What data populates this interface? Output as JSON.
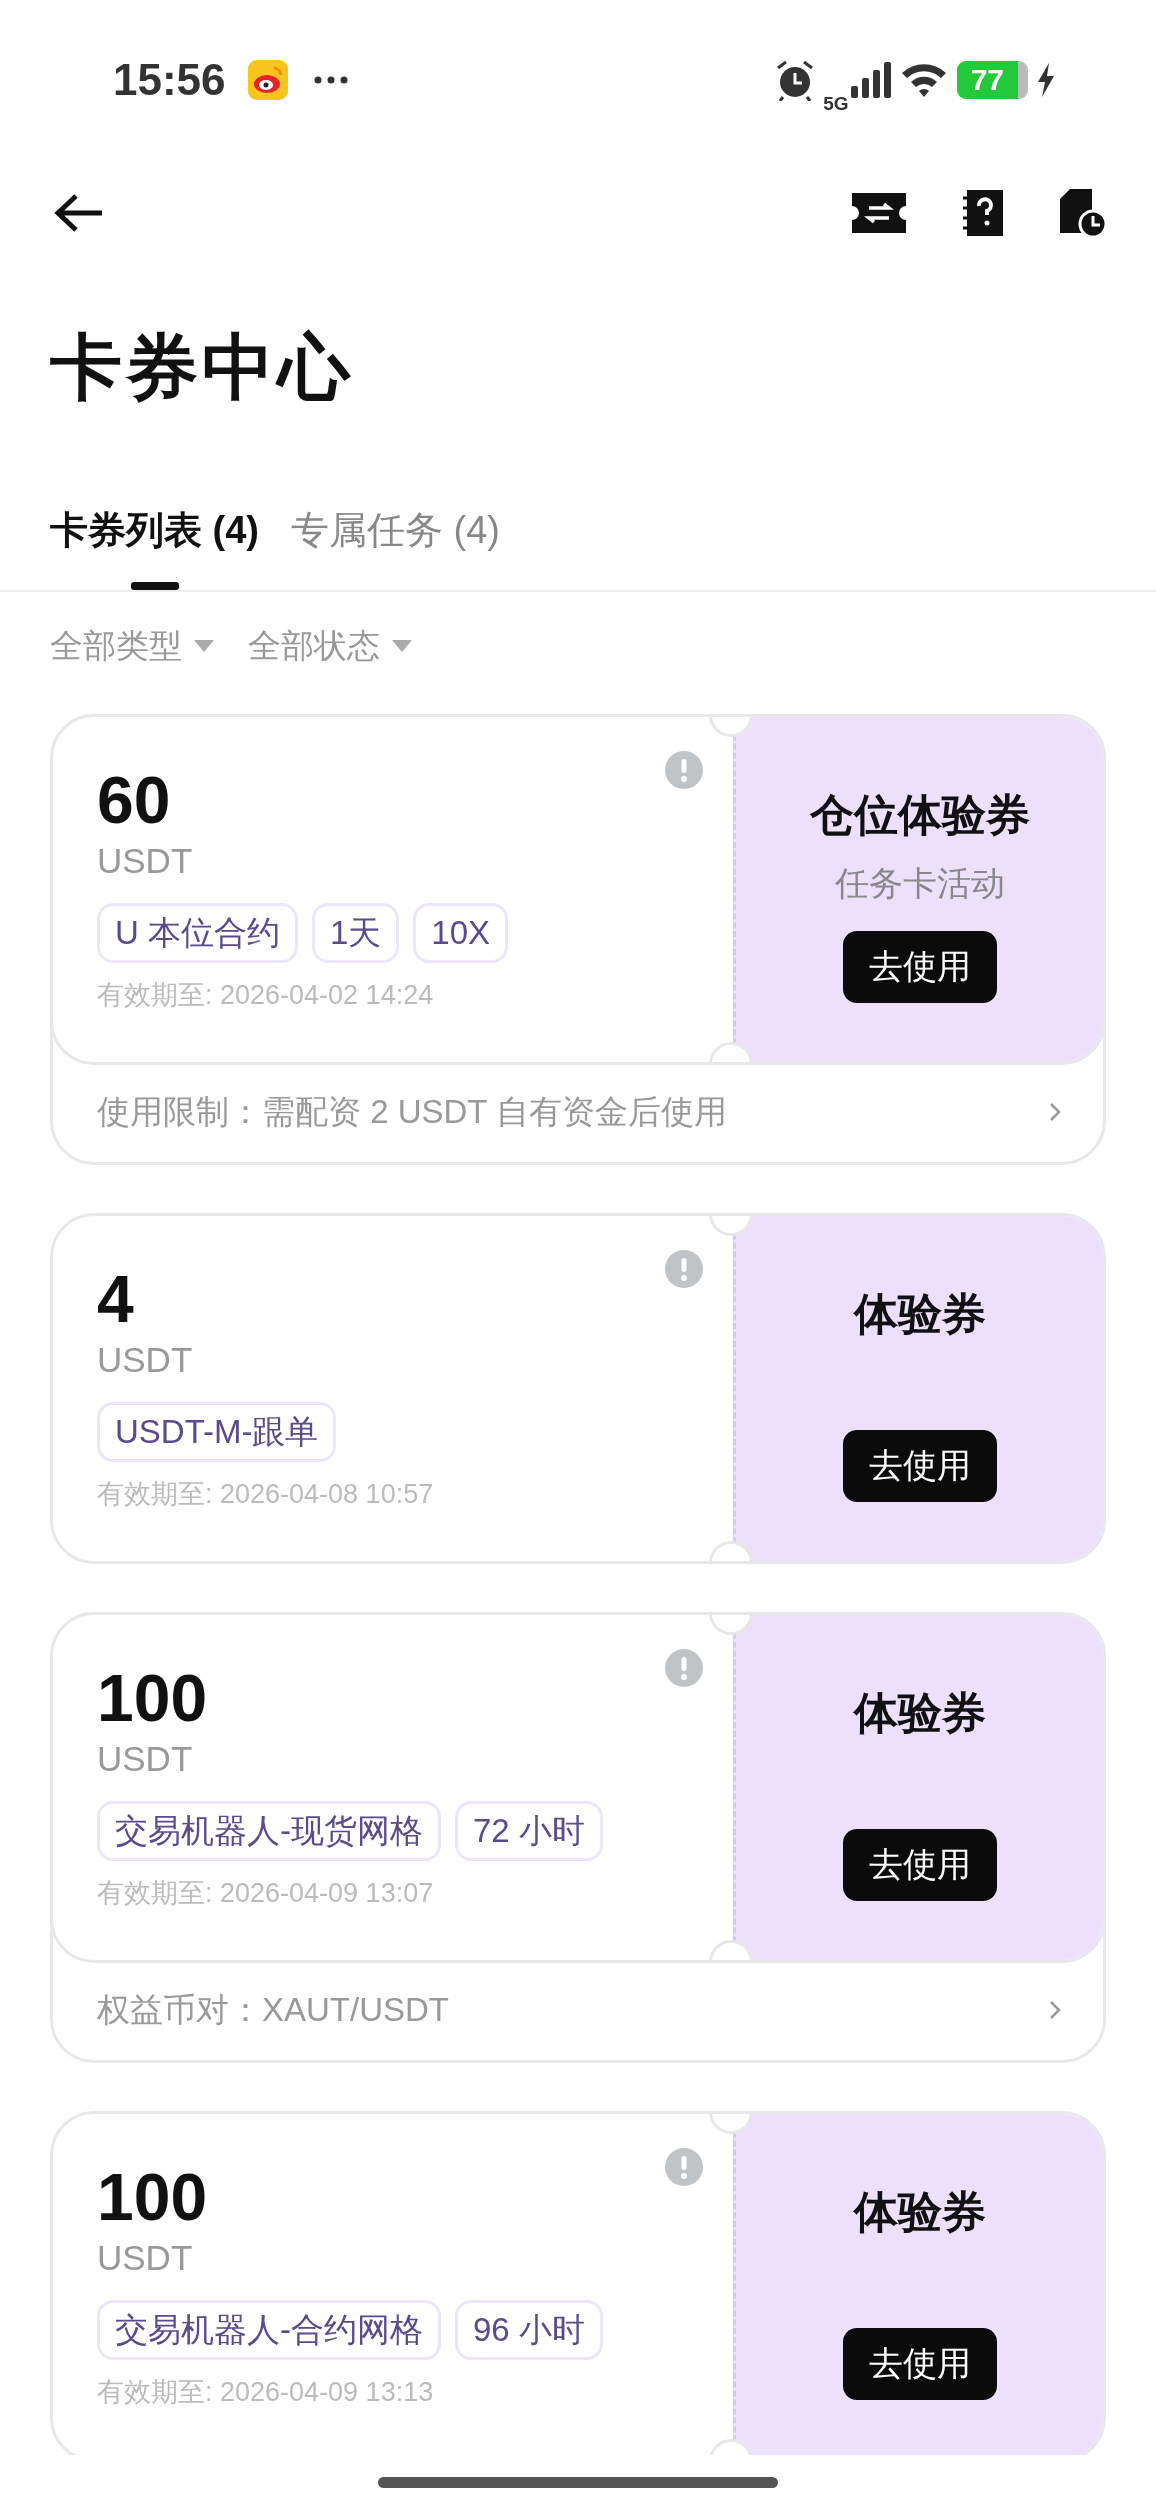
{
  "status_bar": {
    "time": "15:56",
    "network": "5G",
    "battery": "77",
    "charging": true
  },
  "header": {
    "title": "卡券中心"
  },
  "tabs": [
    {
      "label": "卡券列表 (4)",
      "selected": true
    },
    {
      "label": "专属任务 (4)",
      "selected": false
    }
  ],
  "filters": [
    {
      "label": "全部类型"
    },
    {
      "label": "全部状态"
    }
  ],
  "coupons": [
    {
      "amount": "60",
      "unit": "USDT",
      "tags": [
        "U 本位合约",
        "1天",
        "10X"
      ],
      "expiry": "有效期至: 2026-04-02 14:24",
      "name": "仓位体验券",
      "subtitle": "任务卡活动",
      "button": "去使用",
      "footer": "使用限制：需配资 2 USDT 自有资金后使用"
    },
    {
      "amount": "4",
      "unit": "USDT",
      "tags": [
        "USDT-M-跟单"
      ],
      "expiry": "有效期至: 2026-04-08 10:57",
      "name": "体验券",
      "button": "去使用"
    },
    {
      "amount": "100",
      "unit": "USDT",
      "tags": [
        "交易机器人-现货网格",
        "72 小时"
      ],
      "expiry": "有效期至: 2026-04-09 13:07",
      "name": "体验券",
      "button": "去使用",
      "footer": "权益币对：XAUT/USDT"
    },
    {
      "amount": "100",
      "unit": "USDT",
      "tags": [
        "交易机器人-合约网格",
        "96 小时"
      ],
      "expiry": "有效期至: 2026-04-09 13:13",
      "name": "体验券",
      "button": "去使用"
    }
  ]
}
